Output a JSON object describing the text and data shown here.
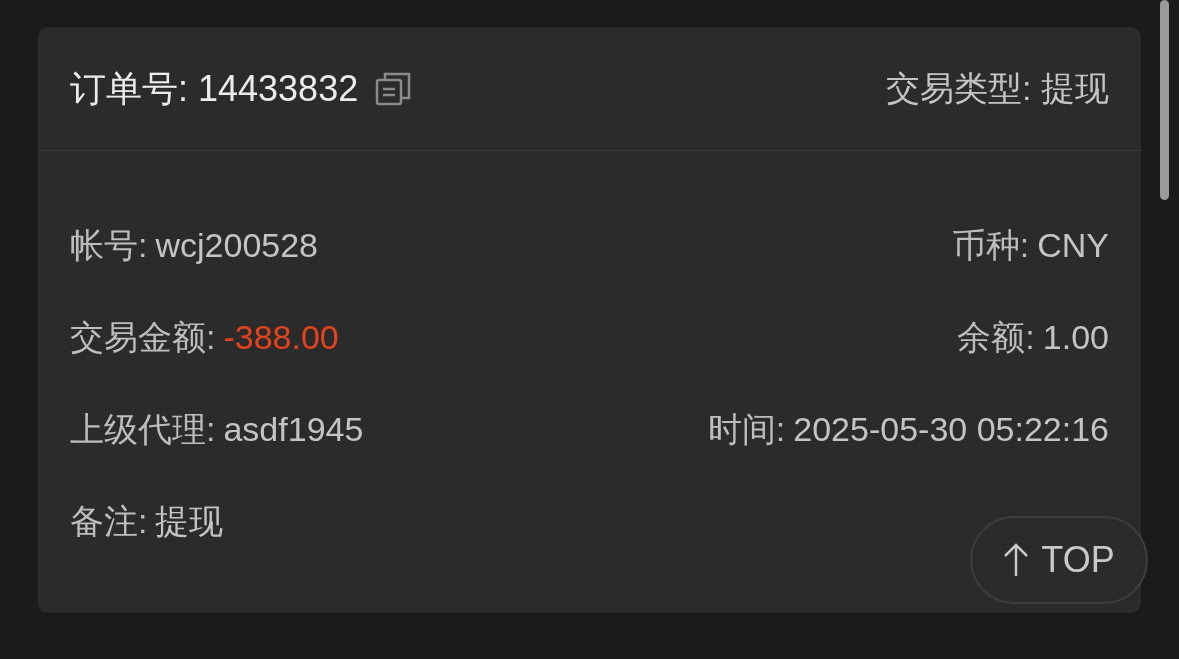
{
  "header": {
    "order_label": "订单号:",
    "order_number": "14433832",
    "transaction_type": "交易类型: 提现"
  },
  "rows": [
    {
      "left": {
        "label": "帐号:",
        "value": "wcj200528",
        "kind": "plain"
      },
      "right": {
        "label": "币种:",
        "value": "CNY",
        "kind": "plain"
      }
    },
    {
      "left": {
        "label": "交易金额:",
        "value": "-388.00",
        "kind": "negative"
      },
      "right": {
        "label": "余额:",
        "value": "1.00",
        "kind": "plain"
      }
    },
    {
      "left": {
        "label": "上级代理:",
        "value": "asdf1945",
        "kind": "plain"
      },
      "right": {
        "label": "时间:",
        "value": "2025-05-30 05:22:16",
        "kind": "plain"
      }
    },
    {
      "left": {
        "label": "备注:",
        "value": "提现",
        "kind": "plain"
      }
    }
  ],
  "top_button": {
    "label": "TOP"
  }
}
